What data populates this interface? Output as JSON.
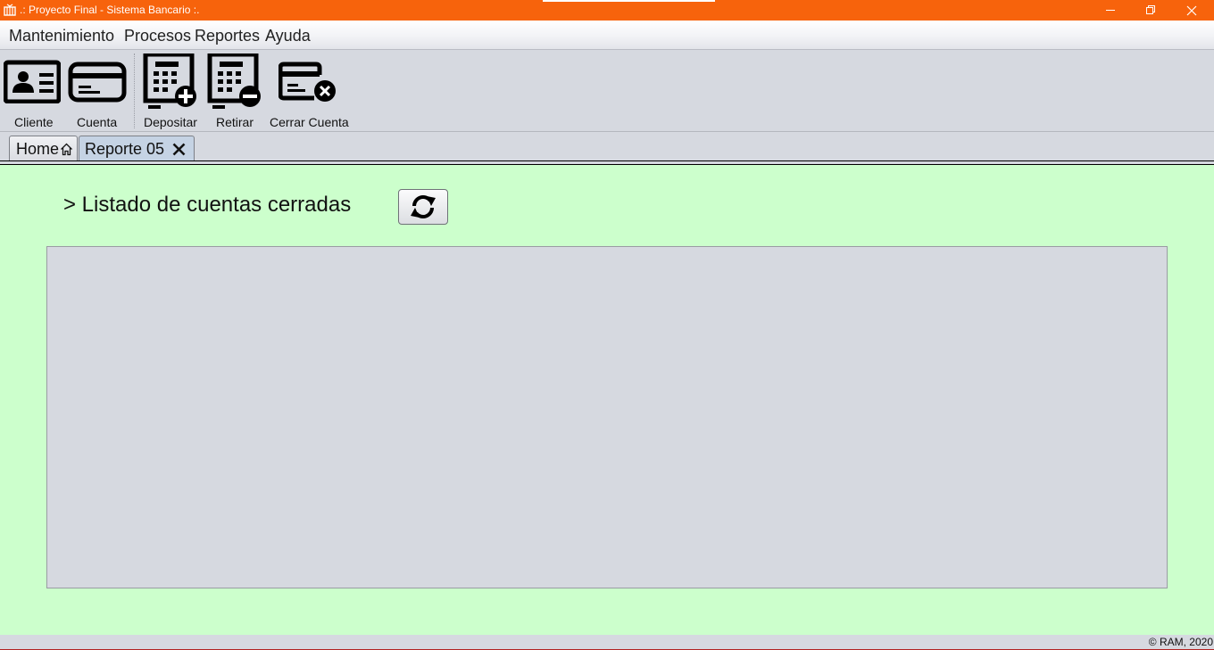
{
  "window": {
    "title": ".: Proyecto Final - Sistema Bancario :.",
    "accent_color": "#f7630c",
    "controls": [
      "minimize-icon",
      "restore-icon",
      "close-icon"
    ]
  },
  "menu": {
    "items": [
      {
        "label": "Mantenimiento"
      },
      {
        "label": "Procesos"
      },
      {
        "label": "Reportes"
      },
      {
        "label": "Ayuda"
      }
    ]
  },
  "toolbar": {
    "buttons": [
      {
        "label": "Cliente",
        "icon": "id-card-icon"
      },
      {
        "label": "Cuenta",
        "icon": "credit-card-icon"
      },
      {
        "label": "Depositar",
        "icon": "calculator-plus-icon"
      },
      {
        "label": "Retirar",
        "icon": "calculator-minus-icon"
      },
      {
        "label": "Cerrar Cuenta",
        "icon": "card-close-icon"
      }
    ]
  },
  "tabs": [
    {
      "label": "Home",
      "icon": "home-icon",
      "active": false
    },
    {
      "label": "Reporte 05",
      "icon": "close-icon",
      "active": true
    }
  ],
  "content": {
    "heading": "> Listado de cuentas cerradas",
    "refresh_icon": "refresh-icon",
    "background_color": "#ccffcc"
  },
  "status": {
    "copyright": "© RAM, 2020"
  }
}
